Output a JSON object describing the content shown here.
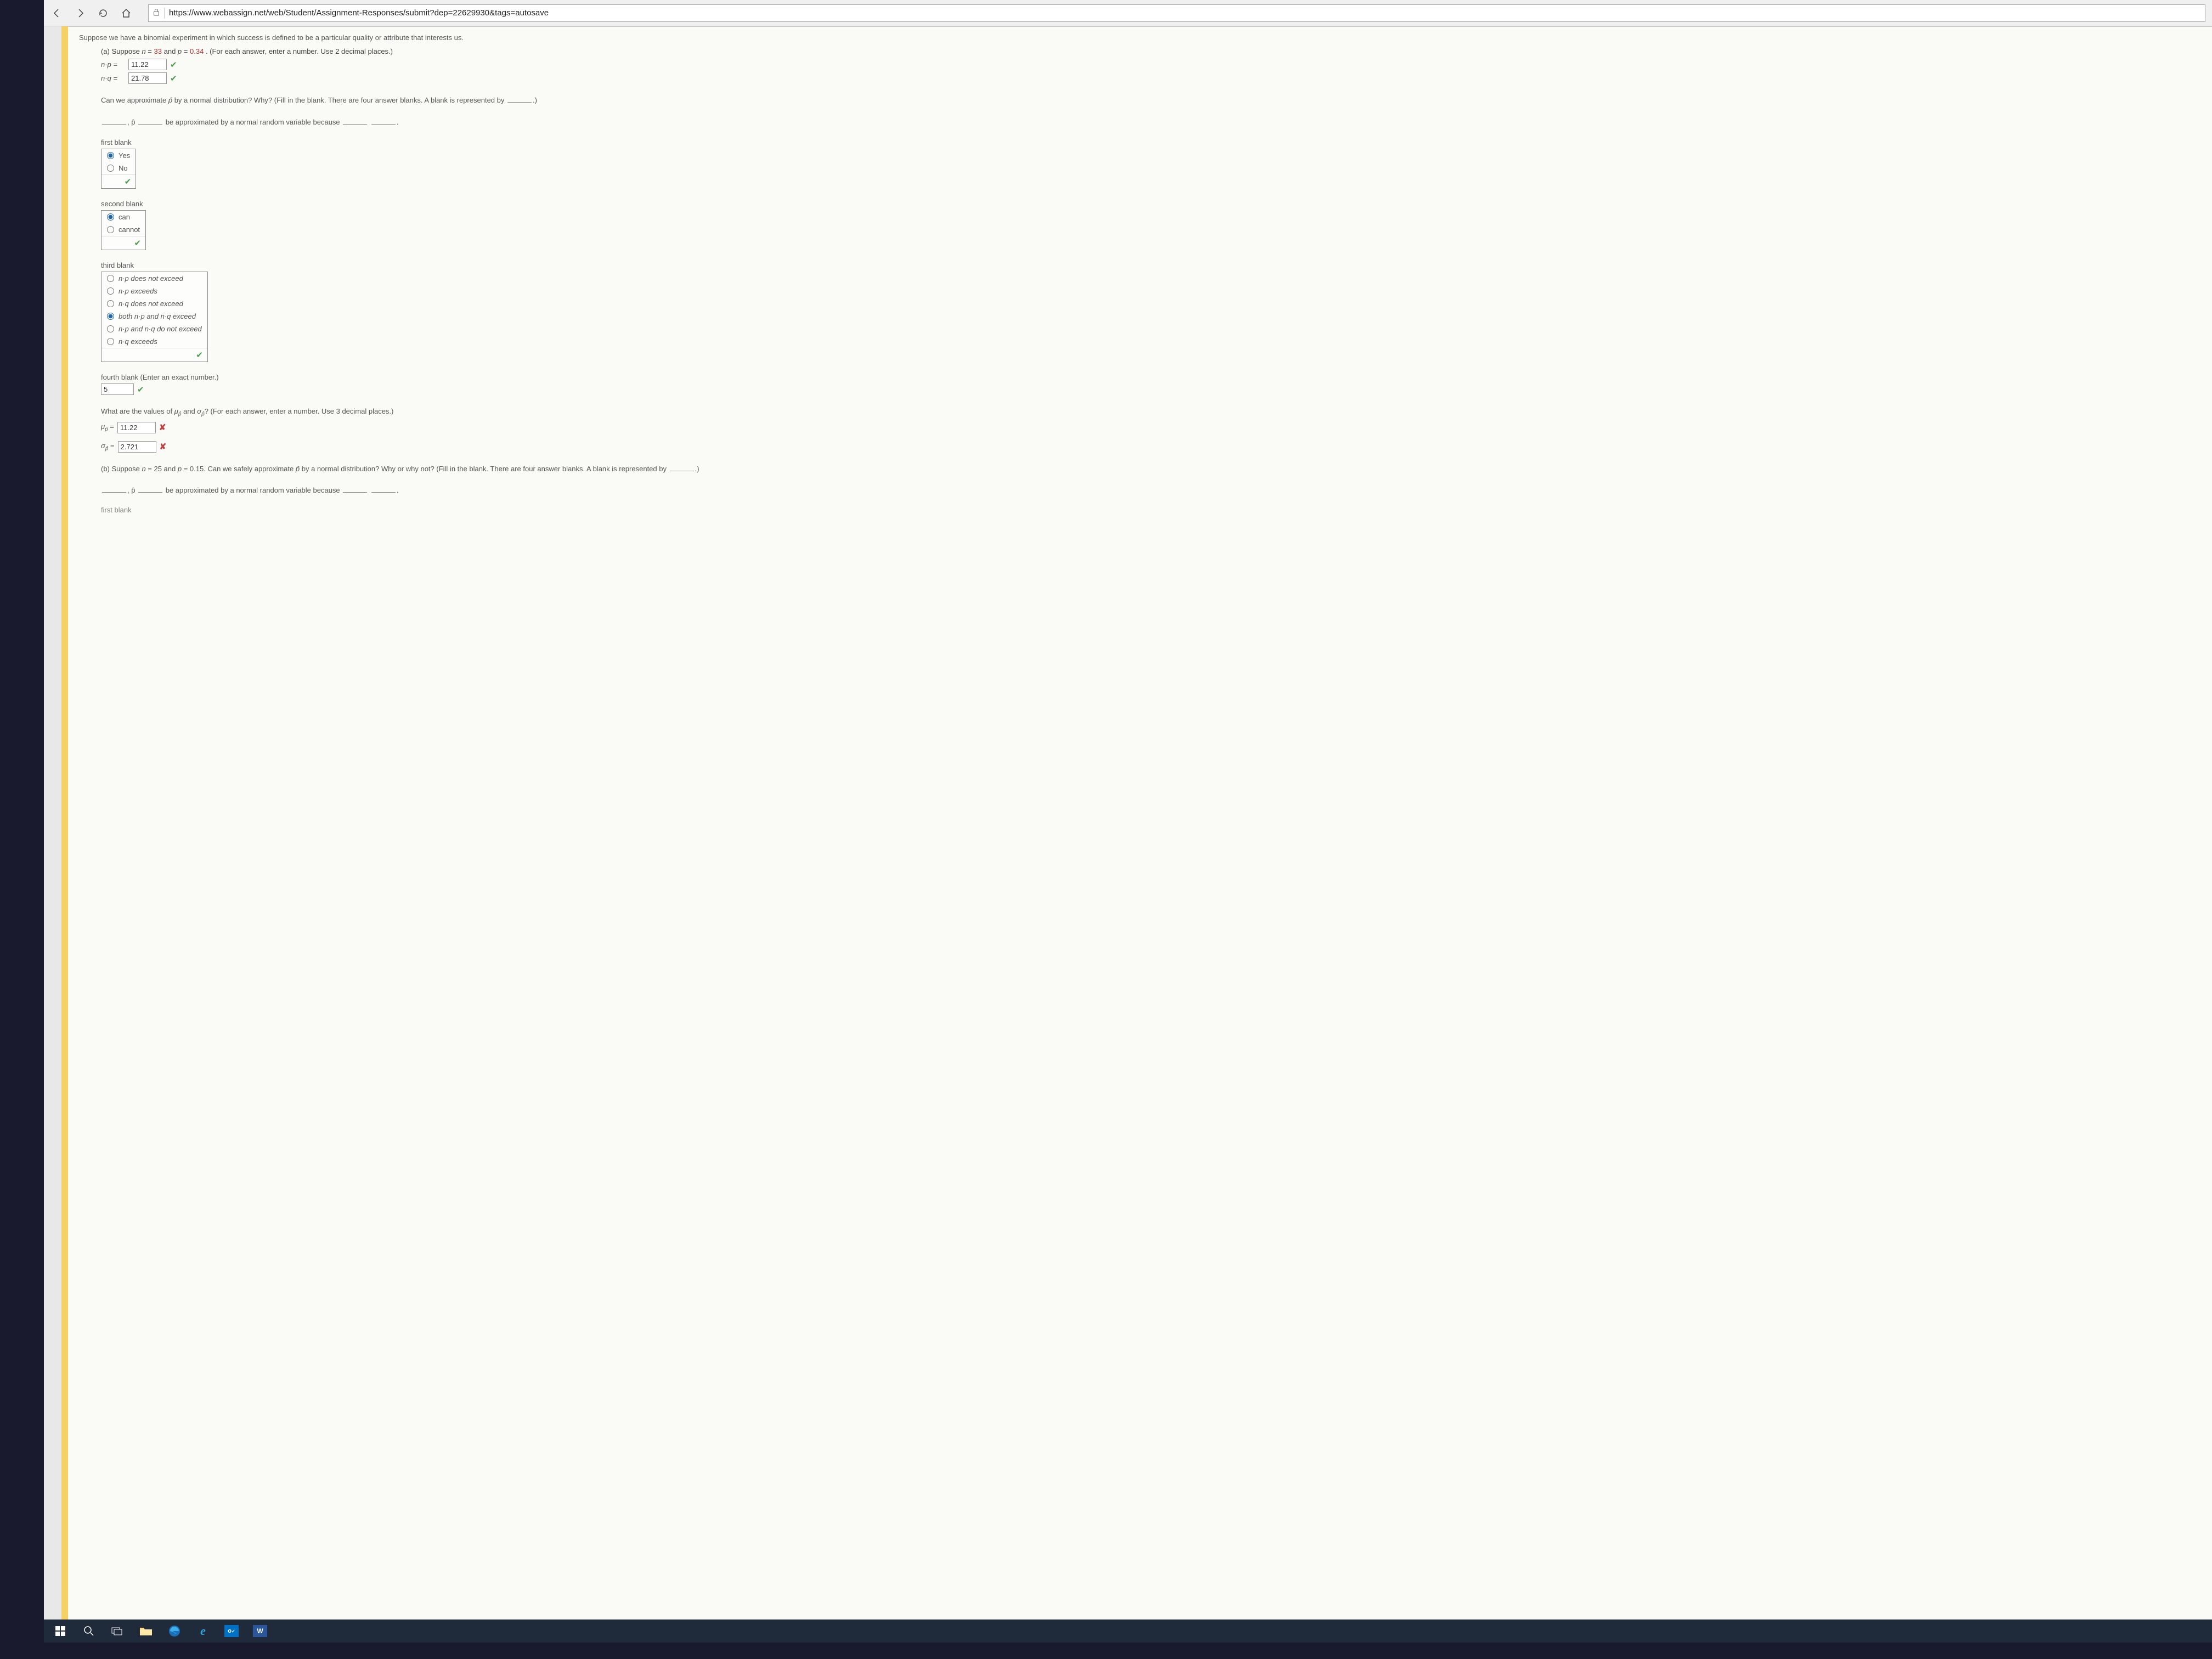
{
  "browser": {
    "url": "https://www.webassign.net/web/Student/Assignment-Responses/submit?dep=22629930&tags=autosave"
  },
  "question": {
    "intro": "Suppose we have a binomial experiment in which success is defined to be a particular quality or attribute that interests us.",
    "part_a_prefix": "(a) Suppose ",
    "part_a_n_label": "n",
    "part_a_n_val": "33",
    "part_a_mid": " and ",
    "part_a_p_label": "p",
    "part_a_p_val": "0.34",
    "part_a_suffix": ". (For each answer, enter a number. Use 2 decimal places.)",
    "np_label": "n·p =",
    "np_value": "11.22",
    "nq_label": "n·q =",
    "nq_value": "21.78",
    "approx_q": "Can we approximate p̂ by a normal distribution? Why? (Fill in the blank. There are four answer blanks. A blank is represented by ____.)",
    "sentence_mid1": ", p̂ ",
    "sentence_mid2": " be approximated by a normal random variable because ",
    "blank1_label": "first blank",
    "blank1_opts": [
      "Yes",
      "No"
    ],
    "blank1_selected": 0,
    "blank2_label": "second blank",
    "blank2_opts": [
      "can",
      "cannot"
    ],
    "blank2_selected": 0,
    "blank3_label": "third blank",
    "blank3_opts": [
      "n·p does not exceed",
      "n·p exceeds",
      "n·q does not exceed",
      "both n·p and n·q exceed",
      "n·p and n·q do not exceed",
      "n·q exceeds"
    ],
    "blank3_selected": 3,
    "blank4_label": "fourth blank (Enter an exact number.)",
    "blank4_value": "5",
    "mu_sigma_q": "What are the values of μp̂ and σp̂? (For each answer, enter a number. Use 3 decimal places.)",
    "mu_label": "μp̂ =",
    "mu_value": "11.22",
    "sigma_label": "σp̂ =",
    "sigma_value": "2.721",
    "part_b": "(b) Suppose n = 25 and p = 0.15. Can we safely approximate p̂ by a normal distribution? Why or why not? (Fill in the blank. There are four answer blanks. A blank is represented by ____.)",
    "sentence_b_mid1": ", p̂ ",
    "sentence_b_mid2": " be approximated by a normal random variable because ",
    "blank1b_label": "first blank"
  }
}
